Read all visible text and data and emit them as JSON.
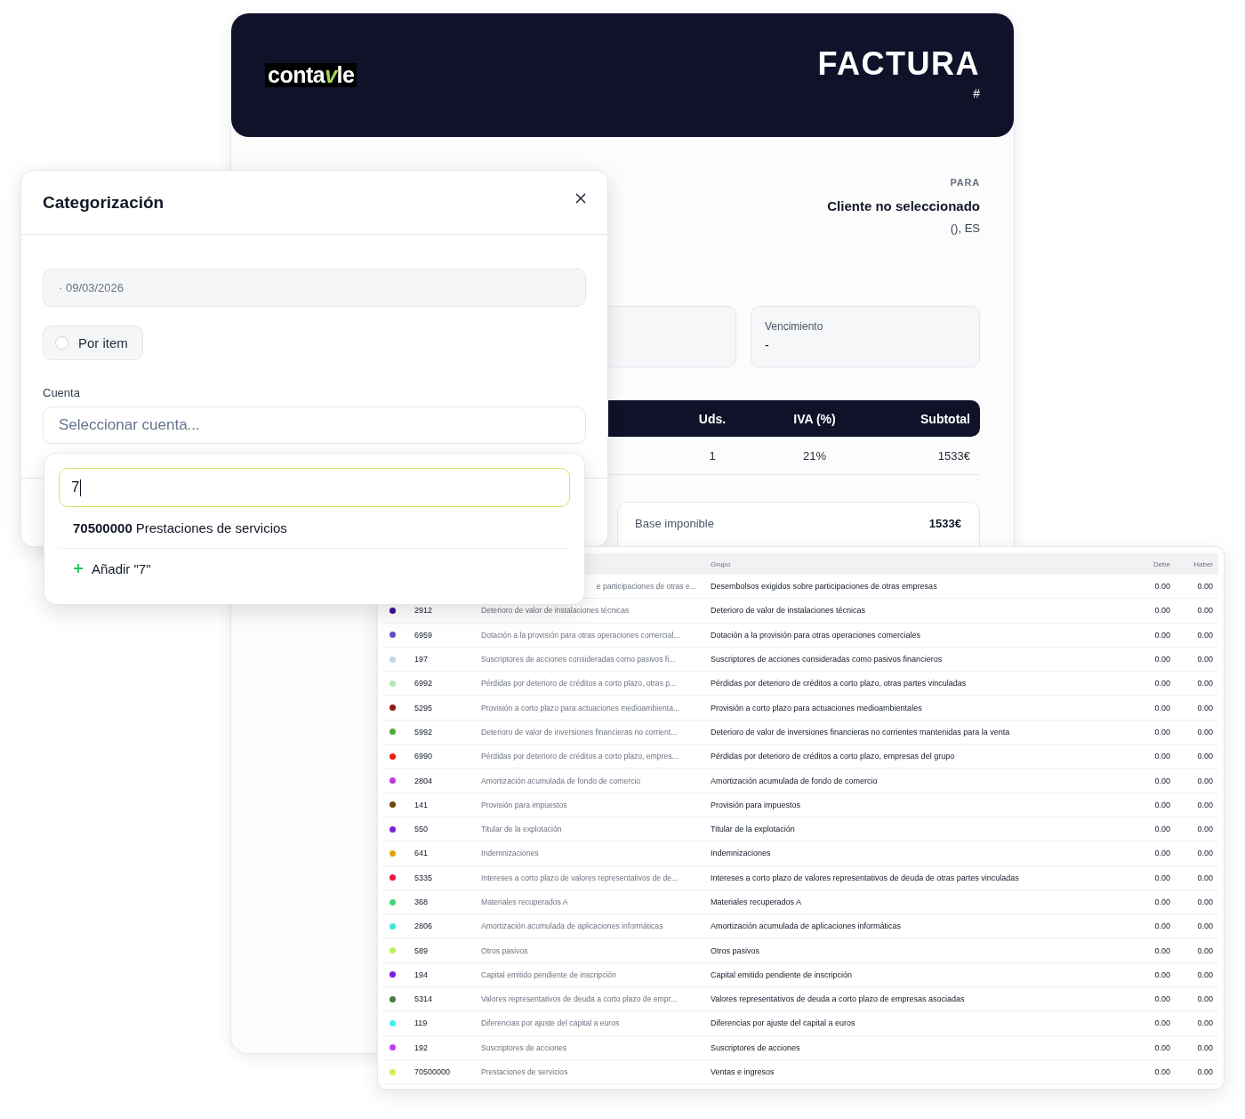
{
  "invoice": {
    "logo": [
      {
        "text": "conta",
        "accent": false
      },
      {
        "text": "v",
        "accent": true
      },
      {
        "text": "le",
        "accent": false
      }
    ],
    "title": "FACTURA",
    "number": "#",
    "to_label": "PARA",
    "client": "Cliente no seleccionado",
    "address": "(), ES",
    "due_label": "Vencimiento",
    "due_value": "-",
    "columns": [
      "Uds.",
      "IVA (%)",
      "Subtotal"
    ],
    "line": [
      "1",
      "21%",
      "1533€"
    ],
    "totals": [
      {
        "label": "Base imponible",
        "value": "1533€"
      }
    ]
  },
  "modal": {
    "title": "Categorización",
    "date": "· 09/03/2026",
    "per_item": {
      "label": "Por item",
      "checked": false
    },
    "account_label": "Cuenta",
    "account_placeholder": "Seleccionar cuenta...",
    "dropdown": {
      "search_value": "7",
      "options": [
        {
          "code": "70500000",
          "label": "Prestaciones de servicios"
        }
      ],
      "add_label": "Añadir \"7\""
    }
  },
  "accounts_table": {
    "columns": {
      "group": "Grupo",
      "debit": "Debe",
      "credit": "Haber"
    },
    "rows": [
      {
        "name": "e participaciones de otras e...",
        "group": "Desembolsos exigidos sobre participaciones de otras empresas",
        "debit": "0.00",
        "credit": "0.00"
      },
      {
        "color": "#3b0fa0",
        "code": "2912",
        "name": "Deterioro de valor de instalaciones técnicas",
        "group": "Deterioro de valor de instalaciones técnicas",
        "debit": "0.00",
        "credit": "0.00"
      },
      {
        "color": "#6050c8",
        "code": "6959",
        "name": "Dotación a la provisión para otras operaciones comercial...",
        "group": "Dotación a la provisión para otras operaciones comerciales",
        "debit": "0.00",
        "credit": "0.00"
      },
      {
        "color": "#c8d4e0",
        "code": "197",
        "name": "Suscriptores de acciones consideradas como pasivos fi...",
        "group": "Suscriptores de acciones consideradas como pasivos financieros",
        "debit": "0.00",
        "credit": "0.00"
      },
      {
        "color": "#b0ecb0",
        "code": "6992",
        "name": "Pérdidas por deterioro de créditos a corto plazo, otras p...",
        "group": "Pérdidas por deterioro de créditos a corto plazo, otras partes vinculadas",
        "debit": "0.00",
        "credit": "0.00"
      },
      {
        "color": "#8b1a10",
        "code": "5295",
        "name": "Provisión a corto plazo para actuaciones medioambienta...",
        "group": "Provisión a corto plazo para actuaciones medioambientales",
        "debit": "0.00",
        "credit": "0.00"
      },
      {
        "color": "#4fa83a",
        "code": "5992",
        "name": "Deterioro de valor de inversiones financieras no corrient...",
        "group": "Deterioro de valor de inversiones financieras no corrientes mantenidas para la venta",
        "debit": "0.00",
        "credit": "0.00"
      },
      {
        "color": "#f01818",
        "code": "6990",
        "name": "Pérdidas por deterioro de créditos a corto plazo, empres...",
        "group": "Pérdidas por deterioro de créditos a corto plazo, empresas del grupo",
        "debit": "0.00",
        "credit": "0.00"
      },
      {
        "color": "#c03ae0",
        "code": "2804",
        "name": "Amortización acumulada de fondo de comercio",
        "group": "Amortización acumulada de fondo de comercio",
        "debit": "0.00",
        "credit": "0.00"
      },
      {
        "color": "#6b4a10",
        "code": "141",
        "name": "Provisión para impuestos",
        "group": "Provisión para impuestos",
        "debit": "0.00",
        "credit": "0.00"
      },
      {
        "color": "#7a20e0",
        "code": "550",
        "name": "Titular de la explotación",
        "group": "Titular de la explotación",
        "debit": "0.00",
        "credit": "0.00"
      },
      {
        "color": "#e8a010",
        "code": "641",
        "name": "Indemnizaciones",
        "group": "Indemnizaciones",
        "debit": "0.00",
        "credit": "0.00"
      },
      {
        "color": "#e81840",
        "code": "5335",
        "name": "Intereses a corto plazo de valores representativos de de...",
        "group": "Intereses a corto plazo de valores representativos de deuda de otras partes vinculadas",
        "debit": "0.00",
        "credit": "0.00"
      },
      {
        "color": "#40d870",
        "code": "368",
        "name": "Materiales recuperados A",
        "group": "Materiales recuperados A",
        "debit": "0.00",
        "credit": "0.00"
      },
      {
        "color": "#40e8d8",
        "code": "2806",
        "name": "Amortización acumulada de aplicaciones informáticas",
        "group": "Amortización acumulada de aplicaciones informáticas",
        "debit": "0.00",
        "credit": "0.00"
      },
      {
        "color": "#c0f060",
        "code": "589",
        "name": "Otros pasivos",
        "group": "Otros pasivos",
        "debit": "0.00",
        "credit": "0.00"
      },
      {
        "color": "#7a20e0",
        "code": "194",
        "name": "Capital emitido pendiente de inscripción",
        "group": "Capital emitido pendiente de inscripción",
        "debit": "0.00",
        "credit": "0.00"
      },
      {
        "color": "#4a7a40",
        "code": "5314",
        "name": "Valores representativos de deuda a corto plazo de empr...",
        "group": "Valores representativos de deuda a corto plazo de empresas asociadas",
        "debit": "0.00",
        "credit": "0.00"
      },
      {
        "color": "#40f0f0",
        "code": "119",
        "name": "Diferencias por ajuste del capital a euros",
        "group": "Diferencias por ajuste del capital a euros",
        "debit": "0.00",
        "credit": "0.00"
      },
      {
        "color": "#c040f0",
        "code": "192",
        "name": "Suscriptores de acciones",
        "group": "Suscriptores de acciones",
        "debit": "0.00",
        "credit": "0.00"
      },
      {
        "color": "#d0f050",
        "code": "70500000",
        "name": "Prestaciones de servicios",
        "group": "Ventas e ingresos",
        "debit": "0.00",
        "credit": "0.00"
      }
    ]
  }
}
